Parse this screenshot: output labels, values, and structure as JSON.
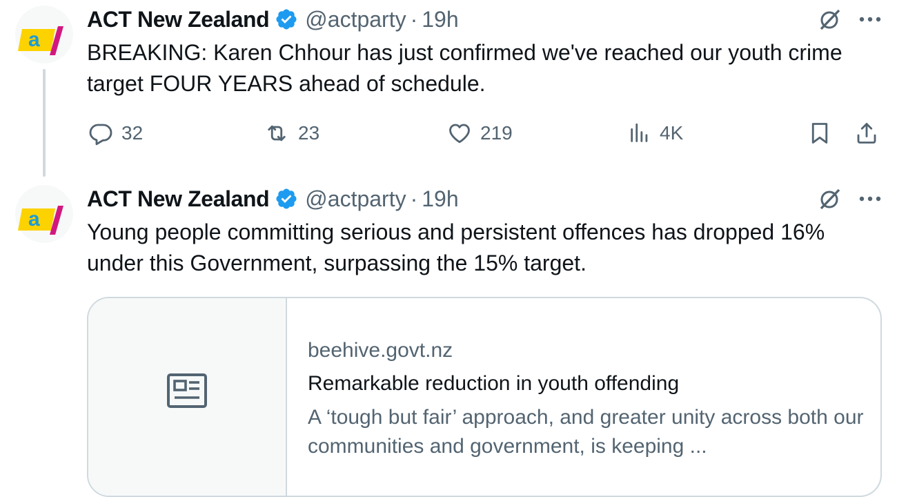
{
  "tweets": [
    {
      "display_name": "ACT New Zealand",
      "handle": "@actparty",
      "separator": "·",
      "time": "19h",
      "text": "BREAKING: Karen Chhour has just confirmed we've reached our youth crime target FOUR YEARS ahead of schedule.",
      "avatar_icon": "act-party-logo",
      "stats": {
        "replies": "32",
        "retweets": "23",
        "likes": "219",
        "views": "4K"
      }
    },
    {
      "display_name": "ACT New Zealand",
      "handle": "@actparty",
      "separator": "·",
      "time": "19h",
      "text": "Young people committing serious and persistent offences has dropped 16% under this Government, surpassing the 15% target.",
      "avatar_icon": "act-party-logo",
      "card": {
        "domain": "beehive.govt.nz",
        "title": "Remarkable reduction in youth offending",
        "description": "A ‘tough but fair’ approach, and greater unity across both our communities and government, is keeping ...",
        "thumb_icon": "article-icon"
      }
    }
  ],
  "colors": {
    "text_primary": "#0f1419",
    "text_secondary": "#536471",
    "verified_blue": "#1d9bf0",
    "border": "#cfd9de",
    "logo_yellow": "#fcd200",
    "logo_blue": "#1c9bd7",
    "logo_pink": "#d2187e"
  }
}
